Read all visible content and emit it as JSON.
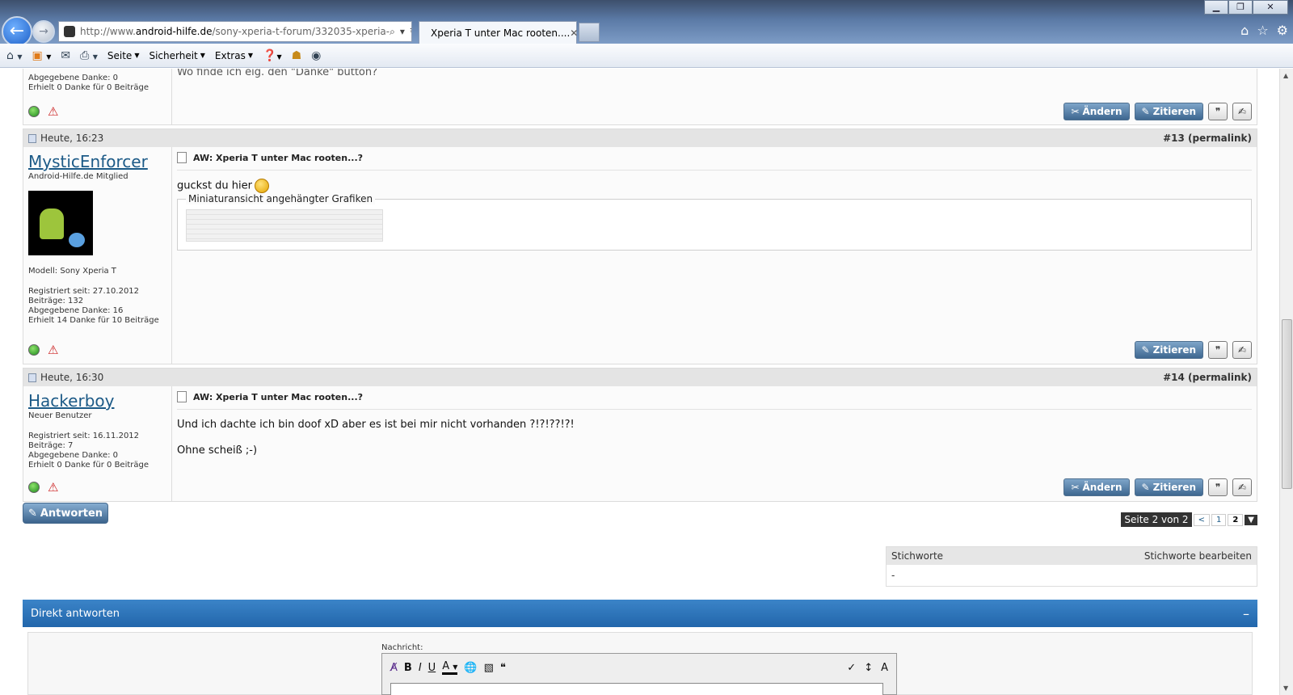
{
  "browser": {
    "url_prefix": "http://www.",
    "url_domain": "android-hilfe.de",
    "url_rest": "/sony-xperia-t-forum/332035-xperia-",
    "tab_title": "Xperia T unter Mac rooten....",
    "menu": [
      "Seite",
      "Sicherheit",
      "Extras"
    ]
  },
  "top_post": {
    "lines": [
      "Abgegebene Danke: 0",
      "Erhielt 0 Danke für 0 Beiträge"
    ],
    "cut_text": "Wo finde ich eig. den \"Danke\" button?",
    "edit_label": "Ändern",
    "quote_label": "Zitieren"
  },
  "posts": [
    {
      "date": "Heute, 16:23",
      "number": "#13 (permalink)",
      "username": "MysticEnforcer",
      "user_title": "Android-Hilfe.de Mitglied",
      "model": "Modell: Sony Xperia T",
      "lines": [
        "Registriert seit: 27.10.2012",
        "Beiträge: 132",
        "Abgegebene Danke: 16",
        "Erhielt 14 Danke für 10 Beiträge"
      ],
      "title": "AW: Xperia T unter Mac rooten...?",
      "text": "guckst du hier",
      "attach_label": "Miniaturansicht angehängter Grafiken",
      "quote_label": "Zitieren"
    },
    {
      "date": "Heute, 16:30",
      "number": "#14 (permalink)",
      "username": "Hackerboy",
      "user_title": "Neuer Benutzer",
      "lines": [
        "Registriert seit: 16.11.2012",
        "Beiträge: 7",
        "Abgegebene Danke: 0",
        "Erhielt 0 Danke für 0 Beiträge"
      ],
      "title": "AW: Xperia T unter Mac rooten...?",
      "text1": "Und ich dachte ich bin doof xD aber es ist bei mir nicht vorhanden ?!?!??!?!",
      "text2": "Ohne scheiß ;-)",
      "edit_label": "Ändern",
      "quote_label": "Zitieren"
    }
  ],
  "reply_button": "Antworten",
  "pager": {
    "label": "Seite 2 von 2",
    "prev": "<",
    "p1": "1",
    "p2": "2"
  },
  "tags": {
    "header": "Stichworte",
    "edit": "Stichworte bearbeiten",
    "value": "-"
  },
  "direct_reply": {
    "title": "Direkt antworten",
    "minimize": "–",
    "message_label": "Nachricht:"
  },
  "editor": {
    "bold": "B",
    "italic": "I",
    "underline": "U",
    "color": "A"
  }
}
